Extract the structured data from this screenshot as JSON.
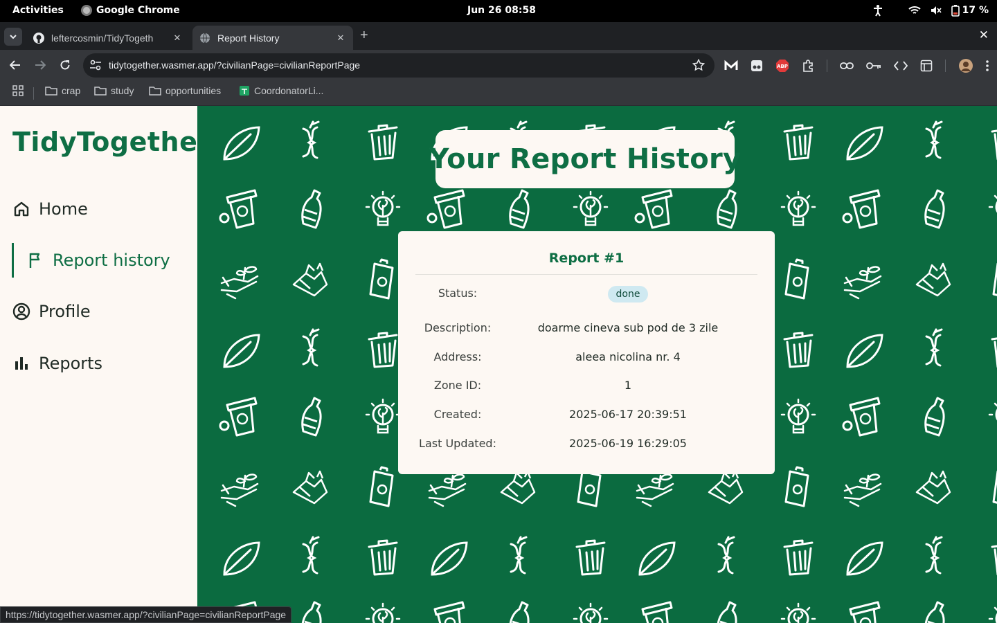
{
  "system": {
    "activities": "Activities",
    "app_name": "Google Chrome",
    "clock": "Jun 26  08:58",
    "battery": "17 %"
  },
  "browser": {
    "tabs": [
      {
        "title": "leftercosmin/TidyTogeth",
        "icon": "github-icon",
        "active": false
      },
      {
        "title": "Report History",
        "icon": "globe-icon",
        "active": true
      }
    ],
    "new_tab": "+",
    "url": "tidytogether.wasmer.app/?civilianPage=civilianReportPage",
    "bookmarks": [
      {
        "label": "crap",
        "icon": "folder-icon"
      },
      {
        "label": "study",
        "icon": "folder-icon"
      },
      {
        "label": "opportunities",
        "icon": "folder-icon"
      },
      {
        "label": "CoordonatorLi...",
        "icon": "sheets-icon"
      }
    ],
    "status_url": "https://tidytogether.wasmer.app/?civilianPage=civilianReportPage"
  },
  "sidebar": {
    "brand": "TidyTogether",
    "items": [
      {
        "label": "Home",
        "icon": "home-icon"
      },
      {
        "label": "Report history",
        "icon": "flag-icon",
        "active": true
      },
      {
        "label": "Profile",
        "icon": "user-circle-icon"
      },
      {
        "label": "Reports",
        "icon": "bar-chart-icon"
      }
    ]
  },
  "main": {
    "title": "Your Report History",
    "report": {
      "title": "Report #1",
      "fields": [
        {
          "label": "Status:",
          "value": "done"
        },
        {
          "label": "Description:",
          "value": "doarme cineva sub pod de 3 zile"
        },
        {
          "label": "Address:",
          "value": "aleea nicolina nr. 4"
        },
        {
          "label": "Zone ID:",
          "value": "1"
        },
        {
          "label": "Created:",
          "value": "2025-06-17 20:39:51"
        },
        {
          "label": "Last Updated:",
          "value": "2025-06-19 16:29:05"
        }
      ]
    }
  },
  "colors": {
    "brand_green": "#0e6e44",
    "background_green": "#0b6b40",
    "panel": "#fdf8f3",
    "badge": "#cfe9f1"
  }
}
